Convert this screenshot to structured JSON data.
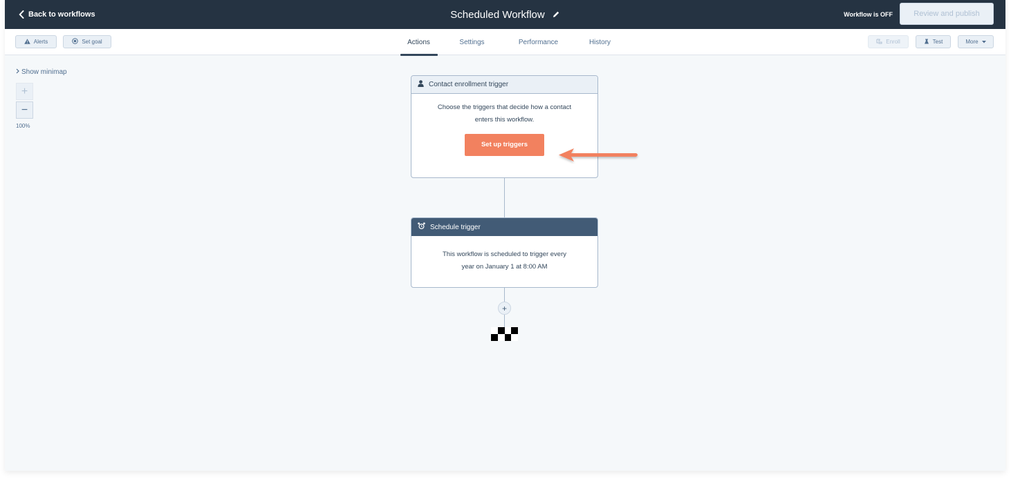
{
  "header": {
    "back_label": "Back to workflows",
    "title": "Scheduled Workflow",
    "status": "Workflow is OFF",
    "publish_label": "Review and publish"
  },
  "toolbar": {
    "alerts_label": "Alerts",
    "set_goal_label": "Set goal",
    "enroll_label": "Enroll",
    "test_label": "Test",
    "more_label": "More"
  },
  "tabs": [
    {
      "label": "Actions",
      "active": true
    },
    {
      "label": "Settings",
      "active": false
    },
    {
      "label": "Performance",
      "active": false
    },
    {
      "label": "History",
      "active": false
    }
  ],
  "canvas": {
    "minimap_label": "Show minimap",
    "zoom_in": "+",
    "zoom_out": "−",
    "zoom_level": "100%",
    "add_action": "+"
  },
  "enrollment_card": {
    "icon": "person-icon",
    "title": "Contact enrollment trigger",
    "description_line1": "Choose the triggers that decide how a contact",
    "description_line2": "enters this workflow.",
    "button_label": "Set up triggers"
  },
  "schedule_card": {
    "icon": "alarm-clock-icon",
    "title": "Schedule trigger",
    "description_line1": "This workflow is scheduled to trigger every",
    "description_line2": "year on January 1 at 8:00 AM"
  },
  "colors": {
    "header_bg": "#253342",
    "accent_orange": "#f2815f",
    "schedule_header": "#425b76",
    "canvas_bg": "#f5f8fa"
  }
}
